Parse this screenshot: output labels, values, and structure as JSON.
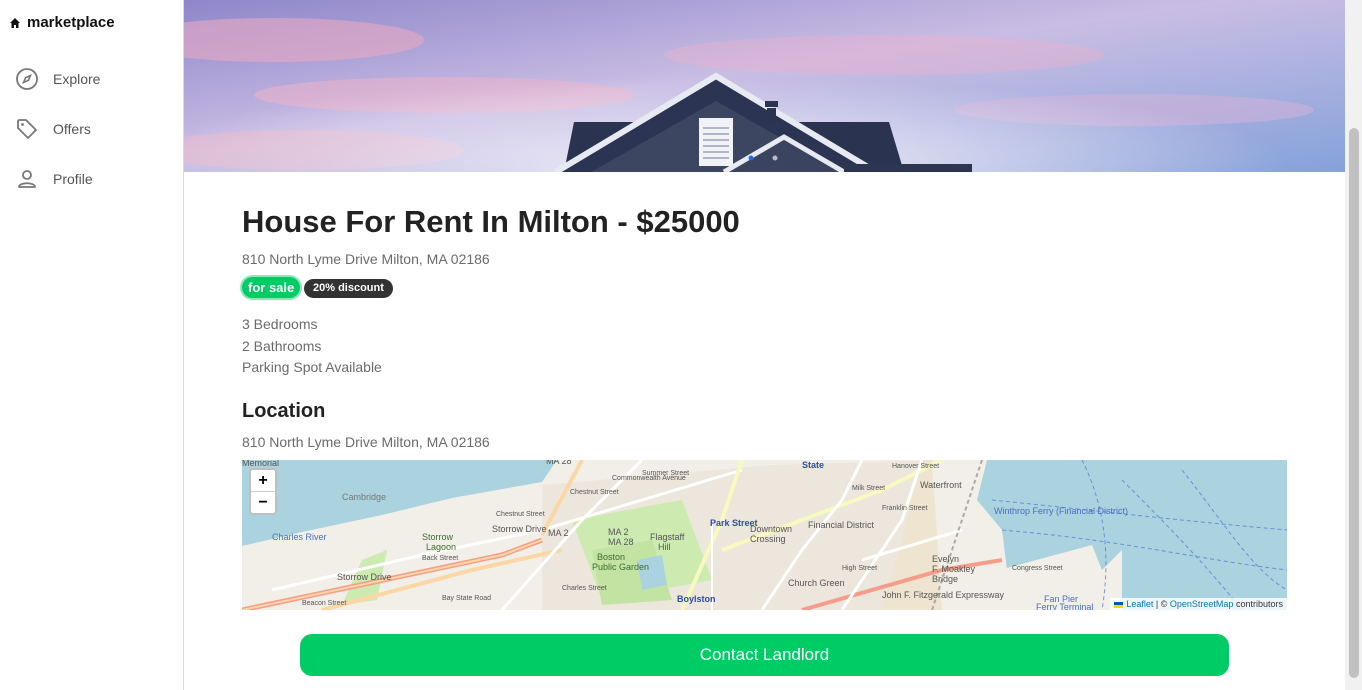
{
  "sidebar": {
    "brand": "marketplace",
    "items": [
      {
        "label": "Explore",
        "icon": "compass-icon"
      },
      {
        "label": "Offers",
        "icon": "tag-icon"
      },
      {
        "label": "Profile",
        "icon": "person-icon"
      }
    ]
  },
  "listing": {
    "title": "House For Rent In Milton - $25000",
    "address": "810 North Lyme Drive Milton, MA 02186",
    "badges": {
      "status": "for sale",
      "discount": "20% discount"
    },
    "features": [
      "3 Bedrooms",
      "2 Bathrooms",
      "Parking Spot Available"
    ]
  },
  "location": {
    "heading": "Location",
    "address": "810 North Lyme Drive Milton, MA 02186",
    "map": {
      "zoom_in": "+",
      "zoom_out": "−",
      "attribution": {
        "leaflet": "Leaflet",
        "separator": "| ©",
        "osm": "OpenStreetMap",
        "suffix": "contributors"
      },
      "labels": [
        "Financial District",
        "Downtown Crossing",
        "Boston Public Garden",
        "Flagstaff Hill",
        "Park Street",
        "Waterfront",
        "Evelyn F. Moakley Bridge",
        "Church Green",
        "Boylston",
        "Storrow Drive",
        "Charles River",
        "Winthrop Ferry (Financial District)",
        "State",
        "MA 2",
        "MA 28",
        "Charles Street",
        "John F. Fitzgerald Expressway",
        "Fan Pier Ferry Terminal",
        "Cambridge",
        "Memorial",
        "Storrow Lagoon",
        "Chestnut Street",
        "Back Street",
        "Beacon Street",
        "Milk Street",
        "Franklin Street",
        "High Street",
        "Summer Street",
        "Hanover Street",
        "Congress Street",
        "Bay State Road",
        "Commonwealth Avenue"
      ]
    }
  },
  "actions": {
    "contact": "Contact Landlord"
  },
  "colors": {
    "accent": "#00cc66",
    "dark_badge": "#333333"
  }
}
